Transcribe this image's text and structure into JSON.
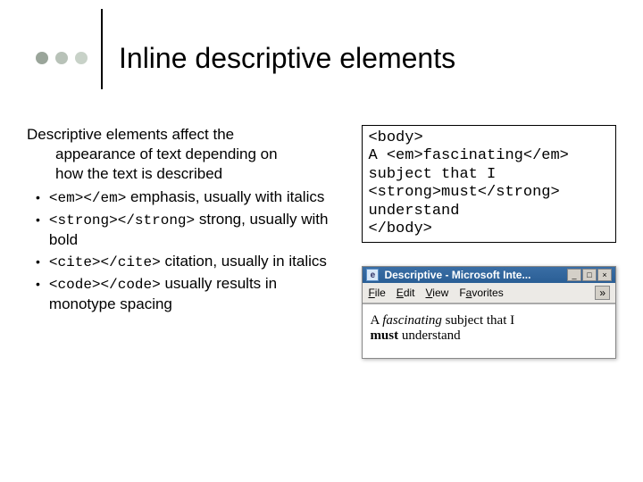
{
  "title": "Inline descriptive elements",
  "intro_line1": "Descriptive elements affect the",
  "intro_line2": "appearance of text depending on",
  "intro_line3": "how the text is described",
  "bullets": [
    {
      "code": "<em></em>",
      "rest": " emphasis, usually with italics"
    },
    {
      "code": "<strong></strong>",
      "rest": " strong, usually with bold"
    },
    {
      "code": "<cite></cite>",
      "rest": " citation, usually in italics"
    },
    {
      "code": "<code></code>",
      "rest": " usually results in monotype spacing"
    }
  ],
  "code_block": "<body>\nA <em>fascinating</em>\nsubject that I\n<strong>must</strong>\nunderstand\n</body>",
  "browser": {
    "title": "Descriptive - Microsoft Inte...",
    "menu": {
      "file": "File",
      "edit": "Edit",
      "view": "View",
      "favorites": "Favorites"
    },
    "rendered_prefix": "A ",
    "rendered_em": "fascinating",
    "rendered_mid": " subject that I ",
    "rendered_strong": "must",
    "rendered_end": " understand"
  }
}
